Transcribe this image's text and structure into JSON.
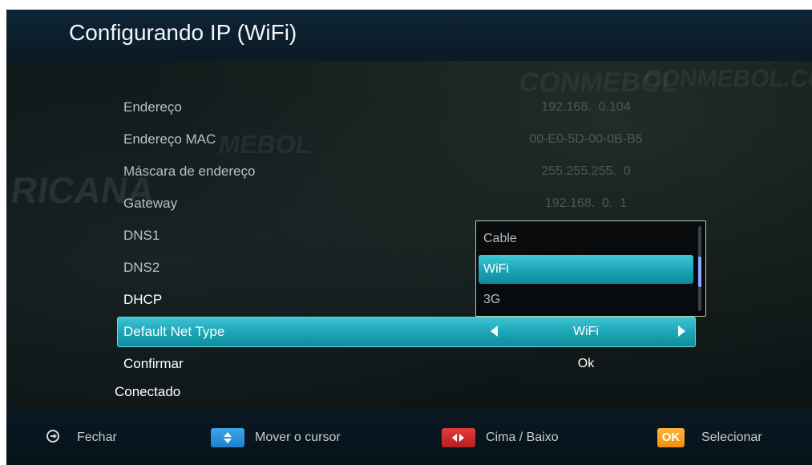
{
  "header": {
    "title": "Configurando IP (WiFi)"
  },
  "settings": {
    "rows": [
      {
        "label": "Endereço",
        "value": "192.168.  0.104"
      },
      {
        "label": "Endereço MAC",
        "value": "00-E0-5D-00-0B-B5"
      },
      {
        "label": "Máscara de endereço",
        "value": "255.255.255.  0"
      },
      {
        "label": "Gateway",
        "value": "192.168.  0.  1"
      },
      {
        "label": "DNS1",
        "value": ""
      },
      {
        "label": "DNS2",
        "value": ""
      },
      {
        "label": "DHCP",
        "value": ""
      },
      {
        "label": "Default Net Type",
        "value": "WiFi"
      },
      {
        "label": "Confirmar",
        "value": "Ok"
      }
    ],
    "status": "Conectado"
  },
  "dropdown": {
    "options": [
      "Cable",
      "WiFi",
      "3G"
    ],
    "selected": "WiFi"
  },
  "background_signage": [
    "CONMEBOL",
    "CONMEBOL.COM",
    "RICANA",
    "MEBOL"
  ],
  "footer": {
    "close_label": "Fechar",
    "move_label": "Mover o cursor",
    "updown_label": "Cima / Baixo",
    "select_key": "OK",
    "select_label": "Selecionar"
  },
  "colors": {
    "highlight": "#1aa3b4",
    "header_bg": "#0e2535",
    "key_blue": "#2b93d8",
    "key_red": "#d02c2e",
    "key_yellow": "#f59a1c"
  }
}
